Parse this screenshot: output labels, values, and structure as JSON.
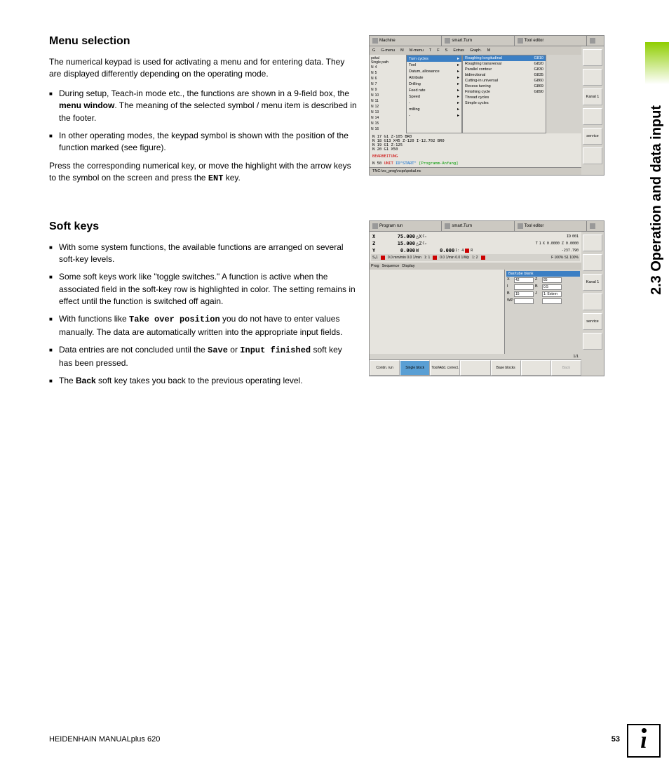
{
  "side_tab": "2.3 Operation and data input",
  "section1": {
    "heading": "Menu selection",
    "para1": "The numerical keypad is used for activating a menu and for entering data. They are displayed differently depending on the operating mode.",
    "li1a": "During setup, Teach-in mode etc., the functions are shown in a 9-field box, the ",
    "li1b_bold": "menu window",
    "li1c": ". The meaning of the selected symbol / menu item is described in the footer.",
    "li2": "In other operating modes, the keypad symbol is shown with the position of the function marked (see figure).",
    "para2a": "Press the corresponding numerical key, or move the highlight with the arrow keys to the symbol on the screen and press the ",
    "para2_key": "ENT",
    "para2b": " key."
  },
  "section2": {
    "heading": "Soft keys",
    "li1": "With some system functions, the available functions are arranged on several soft-key levels.",
    "li2": "Some soft keys work like \"toggle switches.\" A function is active when the associated field in the soft-key row is highlighted in color. The setting remains in effect until the function is switched off again.",
    "li3a": "With functions like ",
    "li3_key": "Take over position",
    "li3b": " you do not have to enter values manually. The data are automatically written into the appropriate input fields.",
    "li4a": "Data entries are not concluded until the ",
    "li4_key1": "Save",
    "li4_mid": " or ",
    "li4_key2": "Input finished",
    "li4b": " soft key has been pressed.",
    "li5a": "The ",
    "li5_key": "Back",
    "li5b": " soft key takes you back to the previous operating level."
  },
  "footer": {
    "left": "HEIDENHAIN MANUALplus 620",
    "page": "53"
  },
  "shot1": {
    "tabs": [
      "Machine",
      "smart.Turn",
      "Tool editor",
      ""
    ],
    "toolbar": [
      "G",
      "G-menu",
      "M",
      "M-menu",
      "T",
      "F",
      "S",
      "Extras",
      "Graph.",
      "M"
    ],
    "left_label": "pokal",
    "left_col_label": "Single path",
    "left_rows": [
      "4",
      "5",
      "6",
      "7",
      "9",
      "10",
      "11",
      "12",
      "13",
      "14",
      "15",
      "16"
    ],
    "menu1_items": [
      "Turn cycles",
      "Tool",
      "Datum, allowance",
      "Attribute",
      "Drilling",
      "Feed rate",
      "Speed",
      "-",
      "milling",
      "-"
    ],
    "menu1_sel": 0,
    "menu2_items": [
      {
        "l": "Roughing longitudinal",
        "r": "G810"
      },
      {
        "l": "Roughing transversal",
        "r": "G820"
      },
      {
        "l": "Parallel contour",
        "r": "G830"
      },
      {
        "l": "bidirectional",
        "r": "G835"
      },
      {
        "l": "Cutting-in universal",
        "r": "G860"
      },
      {
        "l": "Recess turning",
        "r": "G869"
      },
      {
        "l": "Finishing cycle",
        "r": "G890"
      },
      {
        "l": "Thread cycles",
        "r": ""
      },
      {
        "l": "Simple cycles",
        "r": ""
      }
    ],
    "menu2_sel": 0,
    "code_lines": [
      "N 17 G1 Z-105 BR0",
      "N 18 G13 X45 Z-120 I-12.702 BR0",
      "N 19 G1 Z-125",
      "N 20 G1 X50"
    ],
    "bearbeitung": "BEARBEITUNG",
    "unit_line_a": "N  50 ",
    "unit_line_b": "UNIT",
    "unit_line_c": " ID\"START\" ",
    "unit_line_d": "[Programm-Anfang]",
    "status": "TNC:\\nc_prog\\ncps\\pokal.nc",
    "side": [
      "",
      "",
      "Kanal 1",
      "",
      "service",
      ""
    ]
  },
  "shot2": {
    "tabs": [
      "Program run",
      "smart.Turn",
      "Tool editor",
      ""
    ],
    "axes": [
      {
        "ax": "X",
        "val": "75.000",
        "d": "△X",
        "extra": "C₁",
        "id": "ID",
        "idv": "001"
      },
      {
        "ax": "Z",
        "val": "15.000",
        "d": "△Z",
        "extra": "C₂",
        "t": "T",
        "tv": "1",
        "sx": "X 0.0000 Z 0.0000"
      },
      {
        "ax": "Y",
        "val": "0.000",
        "u": "W",
        "v2": "0.000",
        "n": "1: 4",
        "r": "R",
        "coord": "-237.790"
      }
    ],
    "info_row": {
      "s1": "S₁1",
      "f1": "0.0 mm/min 0.0 1/min",
      "n1": "1: 1",
      "f2": "0.0 1/min 0.0 1/Wp",
      "n2": "1: 2",
      "f3": "F 100% S1 100%"
    },
    "toolbar2": [
      "Prog",
      "Sequence",
      "Display"
    ],
    "dialog": {
      "title": "Bar/tube blank",
      "rows": [
        [
          "X",
          "42",
          "Z",
          "85"
        ],
        [
          "I",
          "",
          "B",
          "0.5"
        ],
        [
          "B",
          "15",
          "J",
          "1: Extern"
        ],
        [
          "WP",
          "",
          "",
          ""
        ]
      ]
    },
    "pager": "1/1",
    "softkeys": [
      "Contin. run",
      "Single block",
      "Tool/Add. correct.",
      "",
      "Base blocks",
      "",
      "Back"
    ],
    "softkey_active": 1,
    "side": [
      "",
      "",
      "Kanal 1",
      "",
      "service",
      ""
    ]
  }
}
